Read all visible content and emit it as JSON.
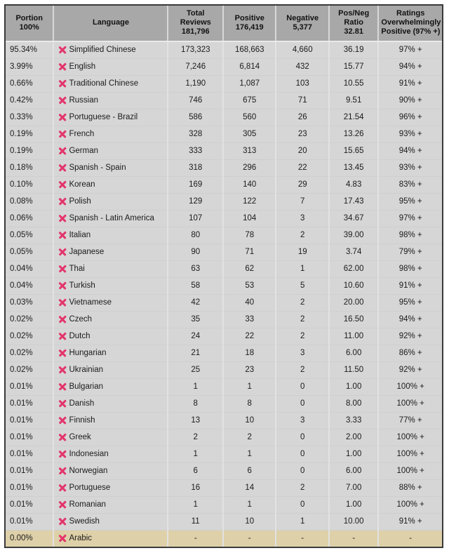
{
  "table": {
    "columns": [
      {
        "key": "portion",
        "lines": [
          "Portion",
          "100%"
        ],
        "name": "portion"
      },
      {
        "key": "language",
        "lines": [
          "Language"
        ],
        "name": "language"
      },
      {
        "key": "total",
        "lines": [
          "Total",
          "Reviews",
          "181,796"
        ],
        "name": "total-reviews"
      },
      {
        "key": "positive",
        "lines": [
          "Positive",
          "176,419"
        ],
        "name": "positive"
      },
      {
        "key": "negative",
        "lines": [
          "Negative",
          "5,377"
        ],
        "name": "negative"
      },
      {
        "key": "ratio",
        "lines": [
          "Pos/Neg",
          "Ratio",
          "32.81"
        ],
        "name": "pos-neg-ratio"
      },
      {
        "key": "ratings",
        "lines": [
          "Ratings",
          "Overwhelmingly",
          "Positive (97% +)"
        ],
        "name": "ratings"
      }
    ],
    "totals": {
      "portion": "100%",
      "total_reviews": "181,796",
      "positive": "176,419",
      "negative": "5,377",
      "ratio": "32.81",
      "ratings": "Positive (97% +)"
    },
    "row_icon": "x-mark-icon",
    "colors": {
      "header_bg": "#a8a8a8",
      "row_bg": "#d6d6d6",
      "highlight_row_bg": "#ded0a8",
      "icon": "#e3356b",
      "border": "#3a3a3a",
      "text": "#1b1b1b"
    },
    "rows": [
      {
        "portion": "95.34%",
        "language": "Simplified Chinese",
        "total": "173,323",
        "positive": "168,663",
        "negative": "4,660",
        "ratio": "36.19",
        "ratings": "97% +",
        "highlight": false
      },
      {
        "portion": "3.99%",
        "language": "English",
        "total": "7,246",
        "positive": "6,814",
        "negative": "432",
        "ratio": "15.77",
        "ratings": "94% +",
        "highlight": false
      },
      {
        "portion": "0.66%",
        "language": "Traditional Chinese",
        "total": "1,190",
        "positive": "1,087",
        "negative": "103",
        "ratio": "10.55",
        "ratings": "91% +",
        "highlight": false
      },
      {
        "portion": "0.42%",
        "language": "Russian",
        "total": "746",
        "positive": "675",
        "negative": "71",
        "ratio": "9.51",
        "ratings": "90% +",
        "highlight": false
      },
      {
        "portion": "0.33%",
        "language": "Portuguese - Brazil",
        "total": "586",
        "positive": "560",
        "negative": "26",
        "ratio": "21.54",
        "ratings": "96% +",
        "highlight": false
      },
      {
        "portion": "0.19%",
        "language": "French",
        "total": "328",
        "positive": "305",
        "negative": "23",
        "ratio": "13.26",
        "ratings": "93% +",
        "highlight": false
      },
      {
        "portion": "0.19%",
        "language": "German",
        "total": "333",
        "positive": "313",
        "negative": "20",
        "ratio": "15.65",
        "ratings": "94% +",
        "highlight": false
      },
      {
        "portion": "0.18%",
        "language": "Spanish - Spain",
        "total": "318",
        "positive": "296",
        "negative": "22",
        "ratio": "13.45",
        "ratings": "93% +",
        "highlight": false
      },
      {
        "portion": "0.10%",
        "language": "Korean",
        "total": "169",
        "positive": "140",
        "negative": "29",
        "ratio": "4.83",
        "ratings": "83% +",
        "highlight": false
      },
      {
        "portion": "0.08%",
        "language": "Polish",
        "total": "129",
        "positive": "122",
        "negative": "7",
        "ratio": "17.43",
        "ratings": "95% +",
        "highlight": false
      },
      {
        "portion": "0.06%",
        "language": "Spanish - Latin America",
        "total": "107",
        "positive": "104",
        "negative": "3",
        "ratio": "34.67",
        "ratings": "97% +",
        "highlight": false
      },
      {
        "portion": "0.05%",
        "language": "Italian",
        "total": "80",
        "positive": "78",
        "negative": "2",
        "ratio": "39.00",
        "ratings": "98% +",
        "highlight": false
      },
      {
        "portion": "0.05%",
        "language": "Japanese",
        "total": "90",
        "positive": "71",
        "negative": "19",
        "ratio": "3.74",
        "ratings": "79% +",
        "highlight": false
      },
      {
        "portion": "0.04%",
        "language": "Thai",
        "total": "63",
        "positive": "62",
        "negative": "1",
        "ratio": "62.00",
        "ratings": "98% +",
        "highlight": false
      },
      {
        "portion": "0.04%",
        "language": "Turkish",
        "total": "58",
        "positive": "53",
        "negative": "5",
        "ratio": "10.60",
        "ratings": "91% +",
        "highlight": false
      },
      {
        "portion": "0.03%",
        "language": "Vietnamese",
        "total": "42",
        "positive": "40",
        "negative": "2",
        "ratio": "20.00",
        "ratings": "95% +",
        "highlight": false
      },
      {
        "portion": "0.02%",
        "language": "Czech",
        "total": "35",
        "positive": "33",
        "negative": "2",
        "ratio": "16.50",
        "ratings": "94% +",
        "highlight": false
      },
      {
        "portion": "0.02%",
        "language": "Dutch",
        "total": "24",
        "positive": "22",
        "negative": "2",
        "ratio": "11.00",
        "ratings": "92% +",
        "highlight": false
      },
      {
        "portion": "0.02%",
        "language": "Hungarian",
        "total": "21",
        "positive": "18",
        "negative": "3",
        "ratio": "6.00",
        "ratings": "86% +",
        "highlight": false
      },
      {
        "portion": "0.02%",
        "language": "Ukrainian",
        "total": "25",
        "positive": "23",
        "negative": "2",
        "ratio": "11.50",
        "ratings": "92% +",
        "highlight": false
      },
      {
        "portion": "0.01%",
        "language": "Bulgarian",
        "total": "1",
        "positive": "1",
        "negative": "0",
        "ratio": "1.00",
        "ratings": "100% +",
        "highlight": false
      },
      {
        "portion": "0.01%",
        "language": "Danish",
        "total": "8",
        "positive": "8",
        "negative": "0",
        "ratio": "8.00",
        "ratings": "100% +",
        "highlight": false
      },
      {
        "portion": "0.01%",
        "language": "Finnish",
        "total": "13",
        "positive": "10",
        "negative": "3",
        "ratio": "3.33",
        "ratings": "77% +",
        "highlight": false
      },
      {
        "portion": "0.01%",
        "language": "Greek",
        "total": "2",
        "positive": "2",
        "negative": "0",
        "ratio": "2.00",
        "ratings": "100% +",
        "highlight": false
      },
      {
        "portion": "0.01%",
        "language": "Indonesian",
        "total": "1",
        "positive": "1",
        "negative": "0",
        "ratio": "1.00",
        "ratings": "100% +",
        "highlight": false
      },
      {
        "portion": "0.01%",
        "language": "Norwegian",
        "total": "6",
        "positive": "6",
        "negative": "0",
        "ratio": "6.00",
        "ratings": "100% +",
        "highlight": false
      },
      {
        "portion": "0.01%",
        "language": "Portuguese",
        "total": "16",
        "positive": "14",
        "negative": "2",
        "ratio": "7.00",
        "ratings": "88% +",
        "highlight": false
      },
      {
        "portion": "0.01%",
        "language": "Romanian",
        "total": "1",
        "positive": "1",
        "negative": "0",
        "ratio": "1.00",
        "ratings": "100% +",
        "highlight": false
      },
      {
        "portion": "0.01%",
        "language": "Swedish",
        "total": "11",
        "positive": "10",
        "negative": "1",
        "ratio": "10.00",
        "ratings": "91% +",
        "highlight": false
      },
      {
        "portion": "0.00%",
        "language": "Arabic",
        "total": "-",
        "positive": "-",
        "negative": "-",
        "ratio": "-",
        "ratings": "-",
        "highlight": true
      }
    ]
  }
}
